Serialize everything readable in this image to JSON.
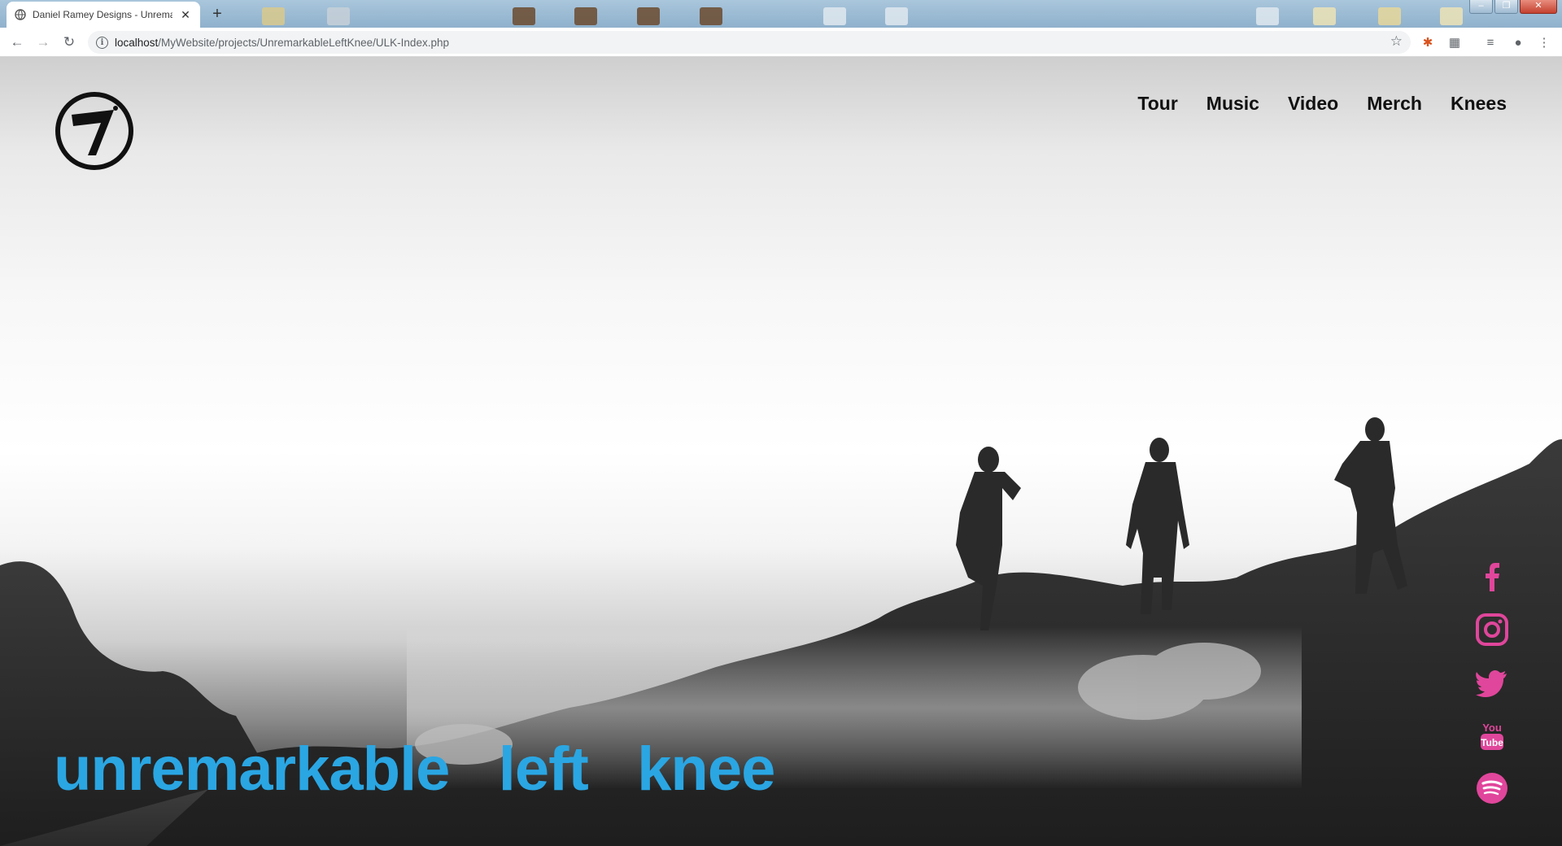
{
  "browser": {
    "tab_title": "Daniel Ramey Designs - Unremarkable Left Knee",
    "new_tab_label": "+",
    "url_host": "localhost",
    "url_path": "/MyWebsite/projects/UnremarkableLeftKnee/ULK-Index.php",
    "window_buttons": {
      "minimize": "–",
      "restore": "❐",
      "close": "✕"
    }
  },
  "site": {
    "logo_icon": "knee-seven-logo-icon",
    "nav": [
      "Tour",
      "Music",
      "Video",
      "Merch",
      "Knees"
    ],
    "band_name": "unremarkable   left   knee",
    "band_name_color": "#2aa6e3",
    "social_color": "#e0469b",
    "social_links": [
      {
        "name": "facebook-icon"
      },
      {
        "name": "instagram-icon"
      },
      {
        "name": "twitter-icon"
      },
      {
        "name": "youtube-icon"
      },
      {
        "name": "spotify-icon"
      }
    ]
  }
}
